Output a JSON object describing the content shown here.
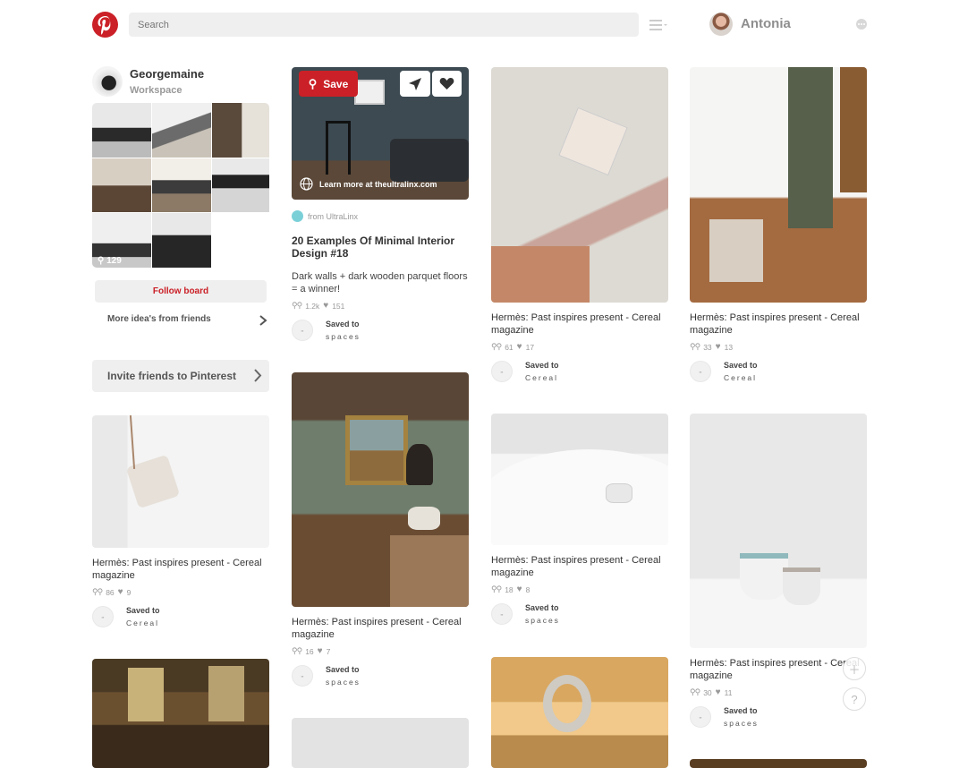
{
  "header": {
    "search_placeholder": "Search",
    "user_name": "Antonia"
  },
  "board": {
    "title": "Georgemaine",
    "subtitle": "Workspace",
    "pin_count": "129",
    "follow_label": "Follow board",
    "more_ideas_label": "More idea's from friends",
    "invite_label": "Invite friends to Pinterest"
  },
  "featured_pin": {
    "save_label": "Save",
    "learn_more": "Learn more at theultralinx.com",
    "source": "from UltraLinx",
    "title": "20 Examples Of Minimal Interior Design #18",
    "description": "Dark walls + dark wooden parquet floors = a winner!",
    "repins": "1.2k",
    "likes": "151",
    "saved_label": "Saved to",
    "saved_board": "spaces"
  },
  "pins": [
    {
      "title": "Hermès: Past inspires present - Cereal magazine",
      "repins": "61",
      "likes": "17",
      "saved_label": "Saved to",
      "saved_board": "Cereal"
    },
    {
      "title": "Hermès: Past inspires present - Cereal magazine",
      "repins": "33",
      "likes": "13",
      "saved_label": "Saved to",
      "saved_board": "Cereal"
    },
    {
      "title": "Hermès: Past inspires present - Cereal magazine",
      "repins": "86",
      "likes": "9",
      "saved_label": "Saved to",
      "saved_board": "Cereal"
    },
    {
      "title": "Hermès: Past inspires present - Cereal magazine",
      "repins": "16",
      "likes": "7",
      "saved_label": "Saved to",
      "saved_board": "spaces"
    },
    {
      "title": "Hermès: Past inspires present - Cereal magazine",
      "repins": "18",
      "likes": "8",
      "saved_label": "Saved to",
      "saved_board": "spaces"
    },
    {
      "title": "Hermès: Past inspires present - Cereal magazine",
      "repins": "30",
      "likes": "11",
      "saved_label": "Saved to",
      "saved_board": "spaces"
    }
  ],
  "icons": {
    "logo": "pinterest-logo-icon",
    "menu": "menu-lines-icon",
    "more": "more-dots-icon",
    "plus": "plus-icon",
    "help": "help-icon"
  },
  "colors": {
    "brand_red": "#cb2027"
  }
}
